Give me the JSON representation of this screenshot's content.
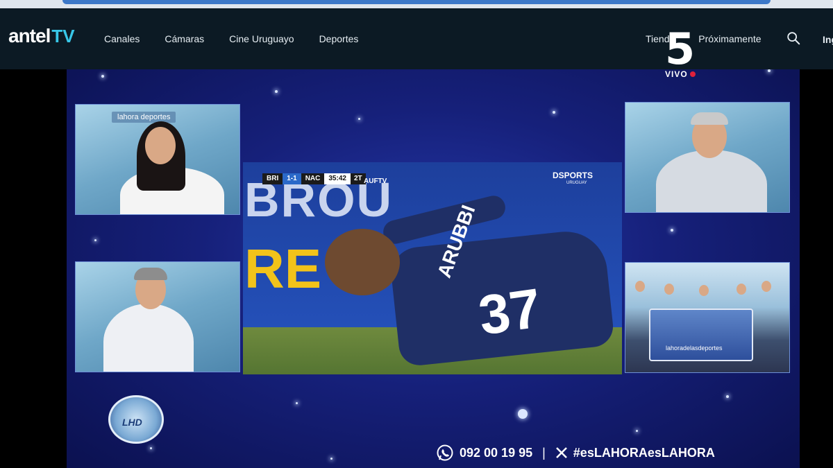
{
  "nav": {
    "logo_brand": "antel",
    "logo_tv": "TV",
    "left_links": [
      "Canales",
      "Cámaras",
      "Cine Uruguayo",
      "Deportes"
    ],
    "right_links": [
      "Tienda",
      "Próximamente"
    ],
    "search_icon": "search-icon",
    "lang_label": "Ing"
  },
  "broadcast": {
    "panel1_tag": "lahora deportes",
    "scoreboard": {
      "home": "BRI",
      "score": "1-1",
      "away": "NAC",
      "clock": "35:42",
      "half": "2T"
    },
    "auf_tv": "AUFTV",
    "dsports": "DSPORTS",
    "dsports_sub": "URUGUAY",
    "wall_text": "BROU",
    "wall_text2": "RE",
    "jersey_name": "ARUBBI",
    "jersey_number": "37",
    "channel_number": "5",
    "channel_live": "VIVO",
    "studio_tag": "lahoradelasdeportes",
    "badge": "LHD",
    "phone": "092 00 19 95",
    "separator": "|",
    "hashtag": "#esLAHORAesLAHORA"
  },
  "colors": {
    "nav_bg": "#0c1a24",
    "accent_tv": "#38c7e8",
    "stage_blue": "#16207a",
    "live_red": "#e0213b"
  }
}
